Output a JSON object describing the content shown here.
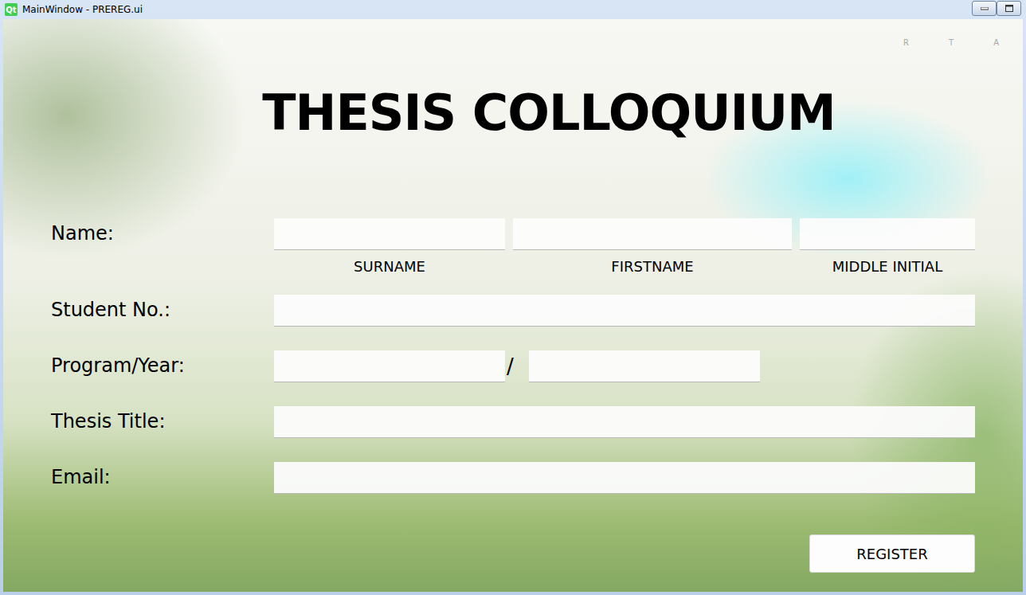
{
  "window": {
    "title": "MainWindow - PREREG.ui",
    "app_icon": "Qt"
  },
  "corner_marks": [
    "R",
    "T",
    "A"
  ],
  "heading": "THESIS COLLOQUIUM",
  "form": [
    {
      "label": "Name:",
      "kind": "name",
      "inputs": [
        {
          "caption": "SURNAME",
          "value": ""
        },
        {
          "caption": "FIRSTNAME",
          "value": ""
        },
        {
          "caption": "MIDDLE INITIAL",
          "value": ""
        }
      ]
    },
    {
      "label": "Student No.:",
      "kind": "single",
      "inputs": [
        {
          "value": ""
        }
      ]
    },
    {
      "label": "Program/Year:",
      "kind": "split",
      "separator": "/",
      "inputs": [
        {
          "value": ""
        },
        {
          "value": ""
        }
      ]
    },
    {
      "label": "Thesis Title:",
      "kind": "single",
      "inputs": [
        {
          "value": ""
        }
      ]
    },
    {
      "label": "Email:",
      "kind": "single",
      "inputs": [
        {
          "value": ""
        }
      ]
    }
  ],
  "register_button": "REGISTER"
}
